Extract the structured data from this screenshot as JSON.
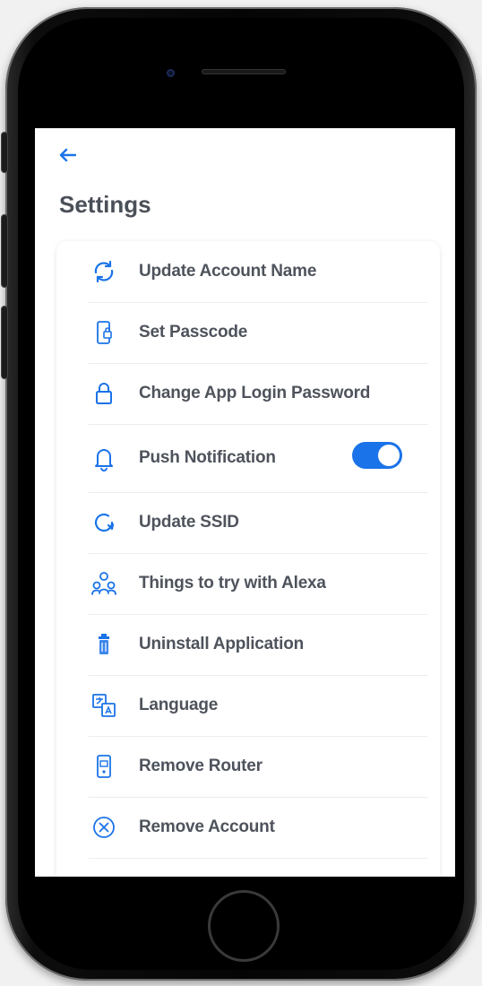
{
  "header": {
    "back_icon": "arrow-left-icon",
    "title": "Settings"
  },
  "settings": {
    "items": [
      {
        "label": "Update Account Name",
        "icon": "sync-icon"
      },
      {
        "label": "Set Passcode",
        "icon": "phone-lock-icon"
      },
      {
        "label": "Change App Login Password",
        "icon": "lock-icon"
      },
      {
        "label": "Push Notification",
        "icon": "bell-icon",
        "toggle": true,
        "toggle_on": true
      },
      {
        "label": "Update SSID",
        "icon": "refresh-icon"
      },
      {
        "label": "Things to try with Alexa",
        "icon": "users-icon"
      },
      {
        "label": "Uninstall Application",
        "icon": "trash-icon"
      },
      {
        "label": "Language",
        "icon": "translate-icon"
      },
      {
        "label": "Remove Router",
        "icon": "router-icon"
      },
      {
        "label": "Remove Account",
        "icon": "close-circle-icon"
      }
    ]
  },
  "colors": {
    "accent": "#1a73e8",
    "text": "#4e535c",
    "title": "#4a4f58"
  }
}
